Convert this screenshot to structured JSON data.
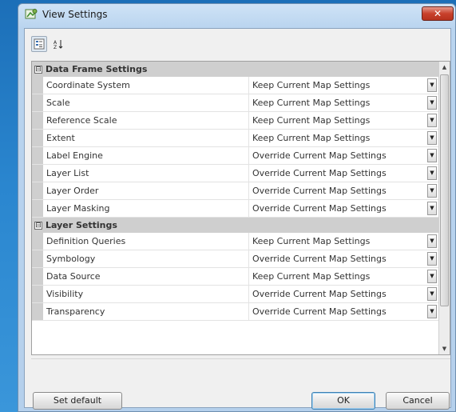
{
  "window": {
    "title": "View Settings",
    "close_label": "✕"
  },
  "groups": [
    {
      "label": "Data Frame Settings",
      "toggle": "⊟",
      "rows": [
        {
          "name": "Coordinate System",
          "value": "Keep Current Map Settings"
        },
        {
          "name": "Scale",
          "value": "Keep Current Map Settings"
        },
        {
          "name": "Reference Scale",
          "value": "Keep Current Map Settings"
        },
        {
          "name": "Extent",
          "value": "Keep Current Map Settings"
        },
        {
          "name": "Label Engine",
          "value": "Override Current Map Settings"
        },
        {
          "name": "Layer List",
          "value": "Override Current Map Settings"
        },
        {
          "name": "Layer Order",
          "value": "Override Current Map Settings"
        },
        {
          "name": "Layer Masking",
          "value": "Override Current Map Settings"
        }
      ]
    },
    {
      "label": "Layer Settings",
      "toggle": "⊟",
      "rows": [
        {
          "name": "Definition Queries",
          "value": "Keep Current Map Settings"
        },
        {
          "name": "Symbology",
          "value": "Override Current Map Settings"
        },
        {
          "name": "Data Source",
          "value": "Keep Current Map Settings"
        },
        {
          "name": "Visibility",
          "value": "Override Current Map Settings"
        },
        {
          "name": "Transparency",
          "value": "Override Current Map Settings"
        }
      ]
    }
  ],
  "buttons": {
    "set_default": "Set default",
    "ok": "OK",
    "cancel": "Cancel"
  },
  "colors": {
    "accent": "#1c6fb8",
    "close": "#c8412c"
  }
}
